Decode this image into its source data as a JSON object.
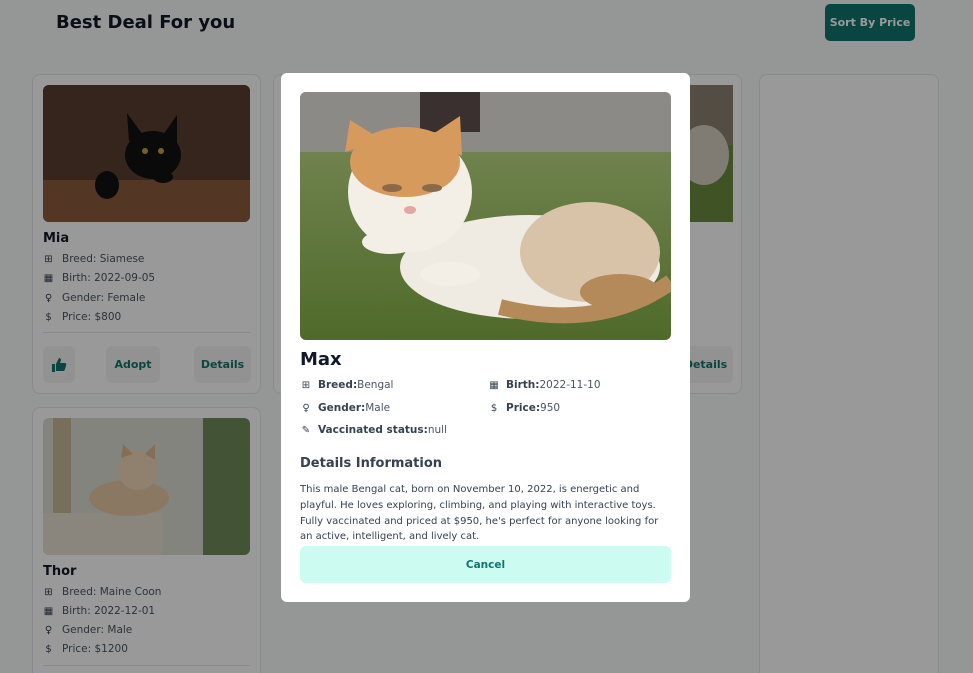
{
  "header": {
    "title": "Best Deal For you",
    "sort_label": "Sort By Price"
  },
  "cards": [
    {
      "name": "Mia",
      "breed": "Breed: Siamese",
      "birth": "Birth: 2022-09-05",
      "gender": "Gender: Female",
      "price": "Price: $800",
      "adopt": "Adopt",
      "details": "Details"
    },
    {
      "name": "Thor",
      "breed": "Breed: Maine Coon",
      "birth": "Birth: 2022-12-01",
      "gender": "Gender: Male",
      "price": "Price: $1200"
    }
  ],
  "hidden_card": {
    "details": "Details"
  },
  "modal": {
    "name": "Max",
    "breed_label": "Breed:",
    "breed": "Bengal",
    "birth_label": "Birth:",
    "birth": "2022-11-10",
    "gender_label": "Gender:",
    "gender": "Male",
    "price_label": "Price:",
    "price": "950",
    "vacc_label": "Vaccinated status:",
    "vacc": "null",
    "details_heading": "Details Information",
    "details_text": "This male Bengal cat, born on November 10, 2022, is energetic and playful. He loves exploring, climbing, and playing with interactive toys. Fully vaccinated and priced at $950, he's perfect for anyone looking for an active, intelligent, and lively cat.",
    "cancel_label": "Cancel"
  },
  "icons": {
    "breed": "grid-icon",
    "birth": "calendar-icon",
    "gender": "gender-icon",
    "price": "dollar-icon",
    "vaccinated": "syringe-icon",
    "like": "thumbs-up-icon"
  },
  "colors": {
    "primary": "#0f766e",
    "cancel_bg": "#ccfbf1"
  }
}
